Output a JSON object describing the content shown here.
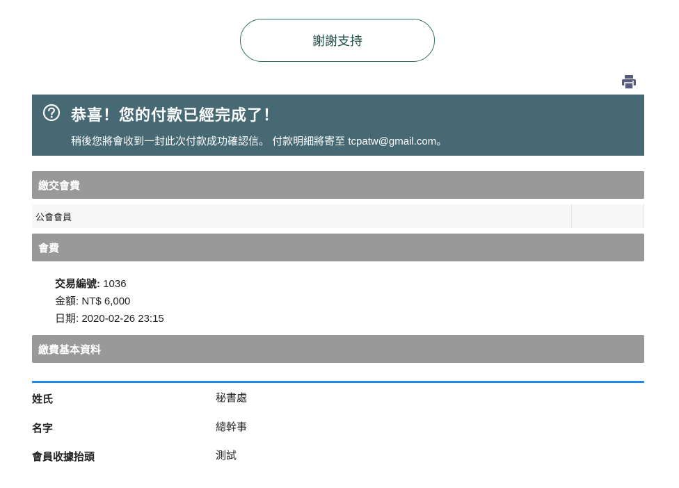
{
  "thanks_button": {
    "label": "謝謝支持"
  },
  "icons": {
    "print": "printer-icon",
    "question": "question-circle-icon"
  },
  "success": {
    "title": "恭喜！您的付款已經完成了！",
    "message": "稍後您將會收到一封此次付款成功確認信。 付款明細將寄至 tcpatw@gmail.com。"
  },
  "sections": {
    "fee": "繳交會費",
    "membership": "會費",
    "profile": "繳費基本資料"
  },
  "fee_items": [
    {
      "name": "公會會員",
      "amount": ""
    }
  ],
  "transaction": {
    "id_label": "交易編號:",
    "id_value": "1036",
    "amount_label": "金額:",
    "amount_value": "NT$ 6,000",
    "date_label": "日期:",
    "date_value": "2020-02-26 23:15"
  },
  "profile": [
    {
      "label": "姓氏",
      "value": "秘書處"
    },
    {
      "label": "名字",
      "value": "總幹事"
    },
    {
      "label": "會員收據抬頭",
      "value": "測試"
    }
  ],
  "colors": {
    "banner": "#466973",
    "section_header": "#999999",
    "accent_rule": "#1f8ae6",
    "button_border": "#2f6f63"
  }
}
